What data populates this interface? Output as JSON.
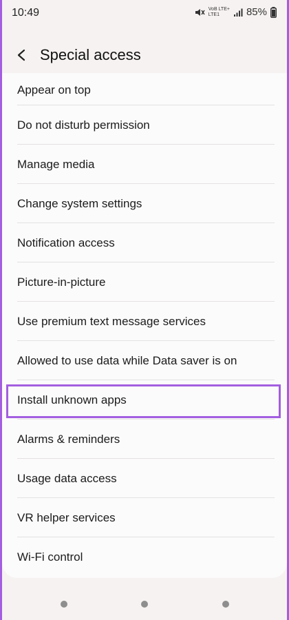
{
  "status_bar": {
    "time": "10:49",
    "network_line1": "VoB LTE+",
    "network_line2": "LTE1",
    "battery": "85%",
    "icons": [
      "mute-icon",
      "signal-icon",
      "battery-icon"
    ]
  },
  "header": {
    "title": "Special access",
    "back_icon": "chevron-left-icon"
  },
  "items": [
    {
      "label": "Appear on top"
    },
    {
      "label": "Do not disturb permission"
    },
    {
      "label": "Manage media"
    },
    {
      "label": "Change system settings"
    },
    {
      "label": "Notification access"
    },
    {
      "label": "Picture-in-picture"
    },
    {
      "label": "Use premium text message services"
    },
    {
      "label": "Allowed to use data while Data saver is on"
    },
    {
      "label": "Install unknown apps"
    },
    {
      "label": "Alarms & reminders"
    },
    {
      "label": "Usage data access"
    },
    {
      "label": "VR helper services"
    },
    {
      "label": "Wi-Fi control"
    }
  ],
  "colors": {
    "highlight": "#a35ee0",
    "background": "#f6f2f1",
    "card": "#fbfbfb"
  }
}
